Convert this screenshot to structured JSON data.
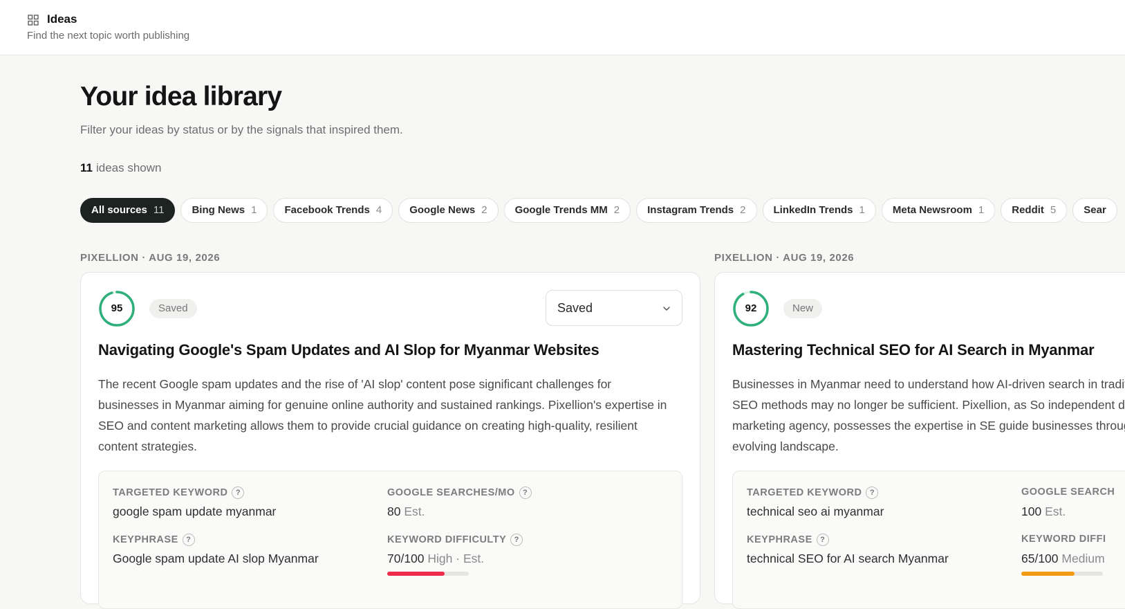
{
  "header": {
    "title": "Ideas",
    "subtitle": "Find the next topic worth publishing",
    "icon": "grid-icon"
  },
  "library": {
    "title": "Your idea library",
    "subtitle": "Filter your ideas by status or by the signals that inspired them.",
    "count_number": "11",
    "count_label": "ideas shown"
  },
  "filters": [
    {
      "label": "All sources",
      "count": "11",
      "active": true
    },
    {
      "label": "Bing News",
      "count": "1"
    },
    {
      "label": "Facebook Trends",
      "count": "4"
    },
    {
      "label": "Google News",
      "count": "2"
    },
    {
      "label": "Google Trends MM",
      "count": "2"
    },
    {
      "label": "Instagram Trends",
      "count": "2"
    },
    {
      "label": "LinkedIn Trends",
      "count": "1"
    },
    {
      "label": "Meta Newsroom",
      "count": "1"
    },
    {
      "label": "Reddit",
      "count": "5"
    },
    {
      "label": "Sear",
      "count": ""
    }
  ],
  "colors": {
    "score_ring": "#2fb07a",
    "difficulty_high": "#ee2b4b",
    "difficulty_medium": "#f59a14"
  },
  "cards": [
    {
      "meta": "PIXELLION · AUG 19, 2026",
      "score": "95",
      "score_fraction": 0.95,
      "badge": "Saved",
      "status_select": "Saved",
      "title": "Navigating Google's Spam Updates and AI Slop for Myanmar Websites",
      "description": "The recent Google spam updates and the rise of 'AI slop' content pose significant challenges for businesses in Myanmar aiming for genuine online authority and sustained rankings. Pixellion's expertise in SEO and content marketing allows them to provide crucial guidance on creating high-quality, resilient content strategies.",
      "targeted_keyword_label": "TARGETED KEYWORD",
      "targeted_keyword": "google spam update myanmar",
      "searches_label": "GOOGLE SEARCHES/MO",
      "searches_value": "80",
      "searches_suffix": "Est.",
      "keyphrase_label": "KEYPHRASE",
      "keyphrase": "Google spam update AI slop Myanmar",
      "difficulty_label": "KEYWORD DIFFICULTY",
      "difficulty_value": "70/100",
      "difficulty_level": "High",
      "difficulty_suffix": "· Est.",
      "difficulty_fraction": 0.7
    },
    {
      "meta": "PIXELLION · AUG 19, 2026",
      "score": "92",
      "score_fraction": 0.92,
      "badge": "New",
      "title": "Mastering Technical SEO for AI Search in Myanmar",
      "description": "Businesses in Myanmar need to understand how AI-driven search in traditional SEO methods may no longer be sufficient. Pixellion, as So independent digital marketing agency, possesses the expertise in SE guide businesses through this evolving landscape.",
      "targeted_keyword_label": "TARGETED KEYWORD",
      "targeted_keyword": "technical seo ai myanmar",
      "searches_label": "GOOGLE SEARCH",
      "searches_value": "100",
      "searches_suffix": "Est.",
      "keyphrase_label": "KEYPHRASE",
      "keyphrase": "technical SEO for AI search Myanmar",
      "difficulty_label": "KEYWORD DIFFI",
      "difficulty_value": "65/100",
      "difficulty_level": "Medium",
      "difficulty_suffix": "",
      "difficulty_fraction": 0.65
    }
  ]
}
